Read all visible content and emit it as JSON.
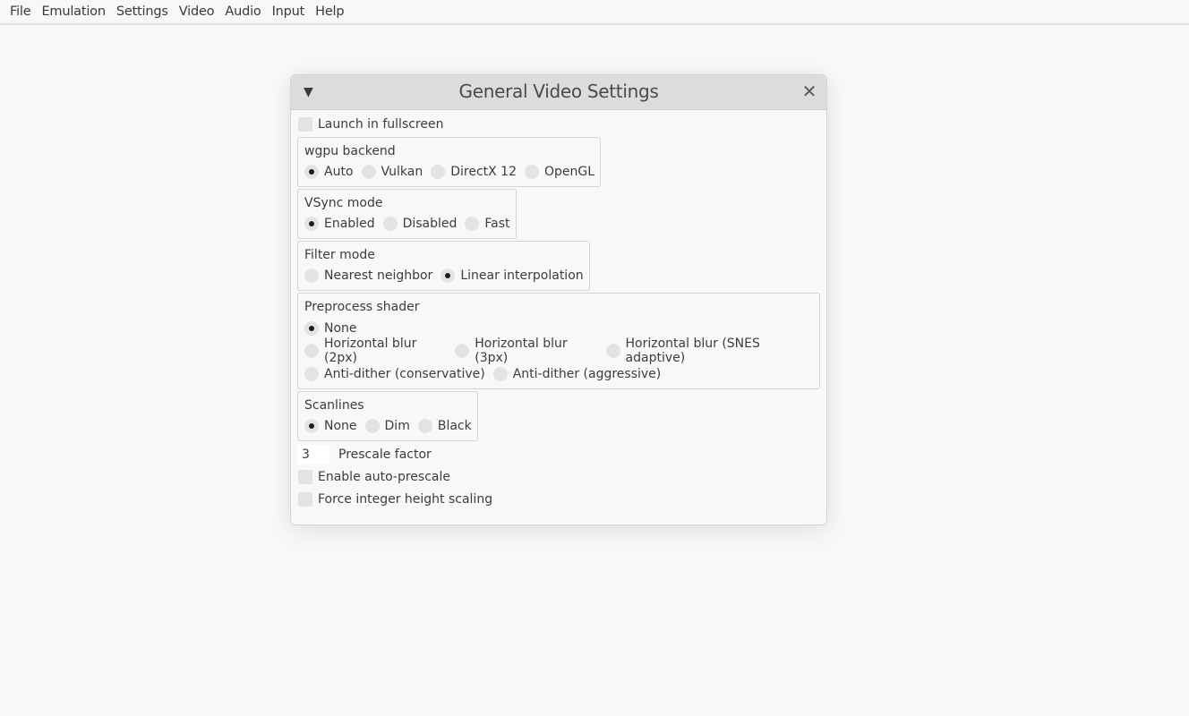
{
  "menubar": {
    "items": [
      "File",
      "Emulation",
      "Settings",
      "Video",
      "Audio",
      "Input",
      "Help"
    ]
  },
  "window": {
    "title": "General Video Settings",
    "collapse_icon": "▼",
    "close_icon": "✕",
    "launch_fullscreen": {
      "label": "Launch in fullscreen",
      "checked": false
    },
    "wgpu_backend": {
      "title": "wgpu backend",
      "options": [
        "Auto",
        "Vulkan",
        "DirectX 12",
        "OpenGL"
      ],
      "selected": "Auto"
    },
    "vsync_mode": {
      "title": "VSync mode",
      "options": [
        "Enabled",
        "Disabled",
        "Fast"
      ],
      "selected": "Enabled"
    },
    "filter_mode": {
      "title": "Filter mode",
      "options": [
        "Nearest neighbor",
        "Linear interpolation"
      ],
      "selected": "Linear interpolation"
    },
    "preprocess_shader": {
      "title": "Preprocess shader",
      "options": [
        "None",
        "Horizontal blur (2px)",
        "Horizontal blur (3px)",
        "Horizontal blur (SNES adaptive)",
        "Anti-dither (conservative)",
        "Anti-dither (aggressive)"
      ],
      "selected": "None"
    },
    "scanlines": {
      "title": "Scanlines",
      "options": [
        "None",
        "Dim",
        "Black"
      ],
      "selected": "None"
    },
    "prescale_factor": {
      "value": "3",
      "label": "Prescale factor"
    },
    "auto_prescale": {
      "label": "Enable auto-prescale",
      "checked": false
    },
    "integer_height": {
      "label": "Force integer height scaling",
      "checked": false
    }
  }
}
